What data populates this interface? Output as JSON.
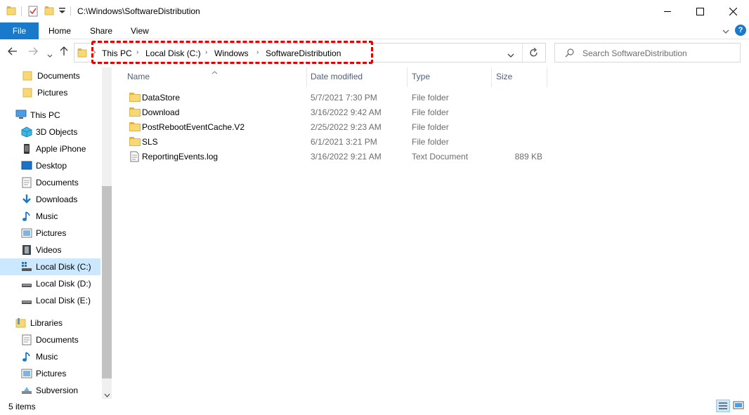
{
  "window": {
    "title": "C:\\Windows\\SoftwareDistribution",
    "minimize_icon": "minimize-icon",
    "maximize_icon": "maximize-icon",
    "close_icon": "close-icon"
  },
  "ribbon": {
    "tabs": [
      "File",
      "Home",
      "Share",
      "View"
    ],
    "help": "?"
  },
  "address": {
    "crumbs": [
      "This PC",
      "Local Disk (C:)",
      "Windows",
      "SoftwareDistribution"
    ]
  },
  "search": {
    "placeholder": "Search SoftwareDistribution"
  },
  "nav": {
    "items": [
      {
        "label": "Documents",
        "icon": "folder-icon"
      },
      {
        "label": "Pictures",
        "icon": "folder-icon"
      },
      {
        "label": "This PC",
        "icon": "computer-icon"
      },
      {
        "label": "3D Objects",
        "icon": "3d-objects-icon"
      },
      {
        "label": "Apple iPhone",
        "icon": "phone-icon"
      },
      {
        "label": "Desktop",
        "icon": "desktop-icon"
      },
      {
        "label": "Documents",
        "icon": "documents-icon"
      },
      {
        "label": "Downloads",
        "icon": "download-icon"
      },
      {
        "label": "Music",
        "icon": "music-icon"
      },
      {
        "label": "Pictures",
        "icon": "pictures-icon"
      },
      {
        "label": "Videos",
        "icon": "videos-icon"
      },
      {
        "label": "Local Disk (C:)",
        "icon": "system-drive-icon",
        "selected": true
      },
      {
        "label": "Local Disk (D:)",
        "icon": "drive-icon"
      },
      {
        "label": "Local Disk (E:)",
        "icon": "drive-icon"
      },
      {
        "label": "Libraries",
        "icon": "libraries-icon"
      },
      {
        "label": "Documents",
        "icon": "documents-icon"
      },
      {
        "label": "Music",
        "icon": "music-icon"
      },
      {
        "label": "Pictures",
        "icon": "pictures-icon"
      },
      {
        "label": "Subversion",
        "icon": "subversion-icon"
      }
    ]
  },
  "columns": {
    "name": "Name",
    "date": "Date modified",
    "type": "Type",
    "size": "Size"
  },
  "files": [
    {
      "name": "DataStore",
      "date": "5/7/2021 7:30 PM",
      "type": "File folder",
      "size": "",
      "icon": "folder-icon"
    },
    {
      "name": "Download",
      "date": "3/16/2022 9:42 AM",
      "type": "File folder",
      "size": "",
      "icon": "folder-icon"
    },
    {
      "name": "PostRebootEventCache.V2",
      "date": "2/25/2022 9:23 AM",
      "type": "File folder",
      "size": "",
      "icon": "folder-icon"
    },
    {
      "name": "SLS",
      "date": "6/1/2021 3:21 PM",
      "type": "File folder",
      "size": "",
      "icon": "folder-icon"
    },
    {
      "name": "ReportingEvents.log",
      "date": "3/16/2022 9:21 AM",
      "type": "Text Document",
      "size": "889 KB",
      "icon": "text-document-icon"
    }
  ],
  "status": {
    "count": "5 items"
  },
  "colors": {
    "accent": "#1979ca",
    "highlight_border": "#e00000",
    "selected_bg": "#cce8ff"
  }
}
